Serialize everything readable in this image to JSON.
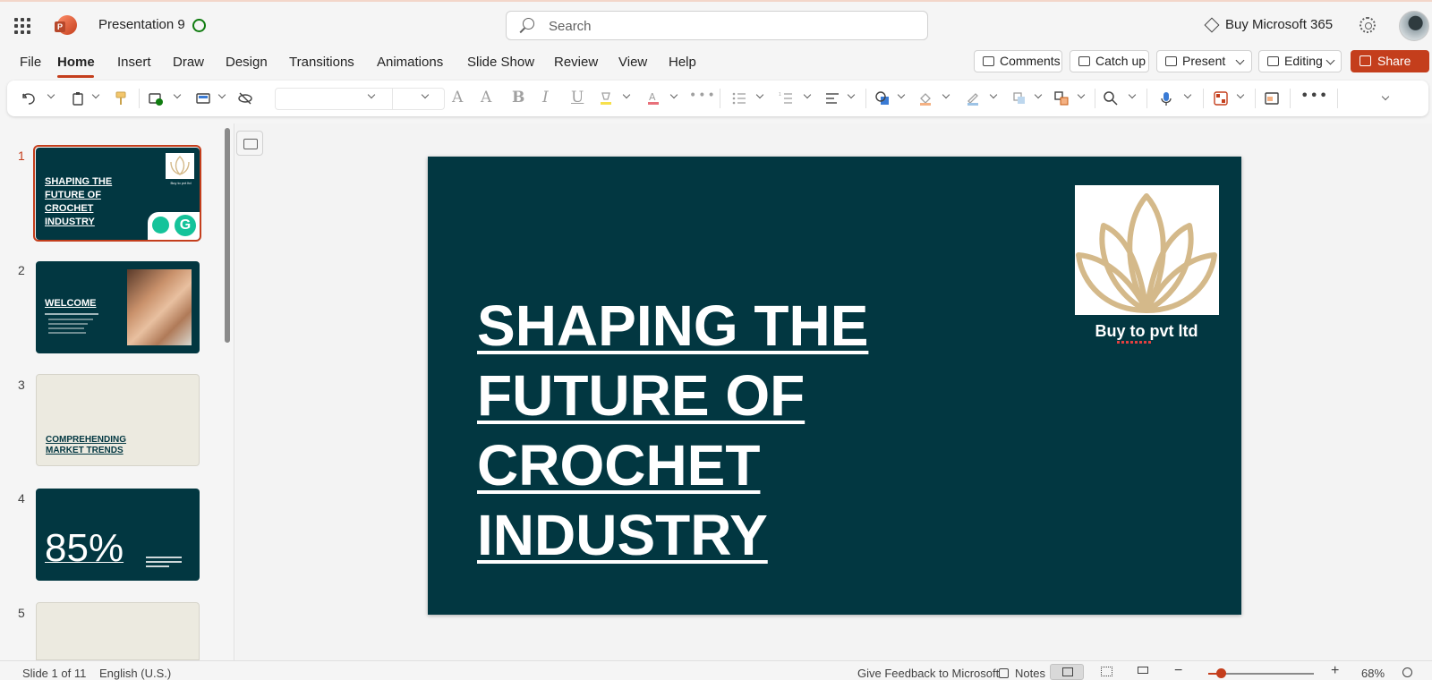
{
  "app": {
    "doc_title": "Presentation 9",
    "search_placeholder": "Search",
    "buy_label": "Buy Microsoft 365"
  },
  "menu": {
    "tabs": [
      "File",
      "Home",
      "Insert",
      "Draw",
      "Design",
      "Transitions",
      "Animations",
      "Slide Show",
      "Review",
      "View",
      "Help"
    ],
    "active_tab": "Home",
    "comments_label": "Comments",
    "catchup_label": "Catch up",
    "present_label": "Present",
    "editing_label": "Editing",
    "share_label": "Share"
  },
  "thumbnails": [
    {
      "number": "1",
      "title": "SHAPING THE FUTURE OF CROCHET INDUSTRY",
      "brand": "Buy to pvt ltd",
      "selected": true
    },
    {
      "number": "2",
      "title": "WELCOME"
    },
    {
      "number": "3",
      "title": "COMPREHENDING MARKET TRENDS"
    },
    {
      "number": "4",
      "stat": "85%"
    },
    {
      "number": "5"
    }
  ],
  "slide": {
    "title_lines": [
      "SHAPING THE ",
      "FUTURE OF ",
      "CROCHET ",
      "INDUSTRY"
    ],
    "brand_caption": "Buy to pvt ltd",
    "background_color": "#023741",
    "logo_color": "#d4b98a"
  },
  "status": {
    "slide_position": "Slide 1 of 11",
    "language": "English (U.S.)",
    "feedback": "Give Feedback to Microsoft",
    "notes": "Notes",
    "zoom_minus": "−",
    "zoom_plus": "+",
    "zoom": "68%"
  },
  "colors": {
    "accent": "#c43e1c",
    "slide_bg": "#023741"
  }
}
